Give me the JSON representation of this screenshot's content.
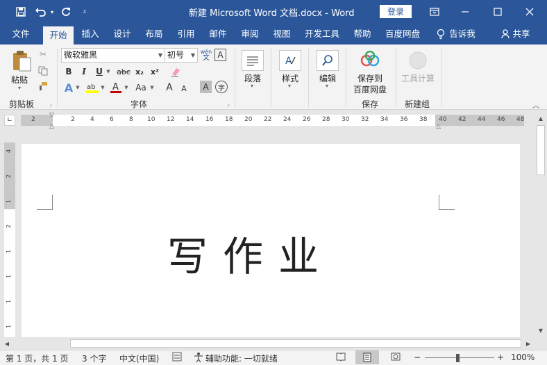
{
  "titlebar": {
    "doc_title": "新建 Microsoft Word 文档.docx  -  Word",
    "login": "登录",
    "qat": {
      "save_icon": "save-icon",
      "undo_icon": "undo-icon",
      "redo_icon": "redo-icon",
      "customize_icon": "customize-icon"
    },
    "window": {
      "restore_ribbon_icon": "ribbon-display-icon",
      "minimize_icon": "minimize-icon",
      "maximize_icon": "maximize-icon",
      "close_icon": "close-icon"
    }
  },
  "tabs": {
    "file": "文件",
    "home": "开始",
    "insert": "插入",
    "design": "设计",
    "layout": "布局",
    "references": "引用",
    "mailings": "邮件",
    "review": "审阅",
    "view": "视图",
    "developer": "开发工具",
    "help": "帮助",
    "baidu": "百度网盘",
    "tellme": "告诉我",
    "share": "共享"
  },
  "ribbon": {
    "clipboard": {
      "paste": "粘贴",
      "label": "剪贴板"
    },
    "font": {
      "name": "微软雅黑",
      "size": "初号",
      "label": "字体",
      "bold": "B",
      "italic": "I",
      "underline": "U",
      "strike": "abc",
      "sub": "x₂",
      "sup": "x²",
      "case": "Aa",
      "grow": "A",
      "shrink": "A",
      "wen": "wén",
      "char_border": "A",
      "char_shading": "A",
      "enclose": "字"
    },
    "paragraph": {
      "label": "段落"
    },
    "styles": {
      "label": "样式"
    },
    "editing": {
      "label": "编辑"
    },
    "save": {
      "line1": "保存到",
      "line2": "百度网盘",
      "label": "保存"
    },
    "newgroup": {
      "tools": "工具计算",
      "label": "新建组"
    }
  },
  "ruler": {
    "ticks_left": [
      "2"
    ],
    "ticks": [
      "2",
      "4",
      "6",
      "8",
      "10",
      "12",
      "14",
      "16",
      "18",
      "20",
      "22",
      "24",
      "26",
      "28",
      "30",
      "32",
      "34",
      "36",
      "38"
    ],
    "ticks_right": [
      "40",
      "42",
      "44",
      "46",
      "48"
    ],
    "vticks": [
      "4",
      "2",
      "1",
      "2",
      "1",
      "1",
      "1",
      "1"
    ]
  },
  "document": {
    "text": "写作业"
  },
  "status": {
    "page": "第 1 页，共 1 页",
    "words": "3 个字",
    "lang": "中文(中国)",
    "accessibility": "辅助功能: 一切就绪",
    "zoom": "100%",
    "minus": "−",
    "plus": "+"
  },
  "colors": {
    "brand": "#2b579a",
    "ribbon": "#f3f3f3",
    "canvas": "#e6e6e6",
    "highlight": "#ffff00",
    "font_red": "#c00000"
  }
}
